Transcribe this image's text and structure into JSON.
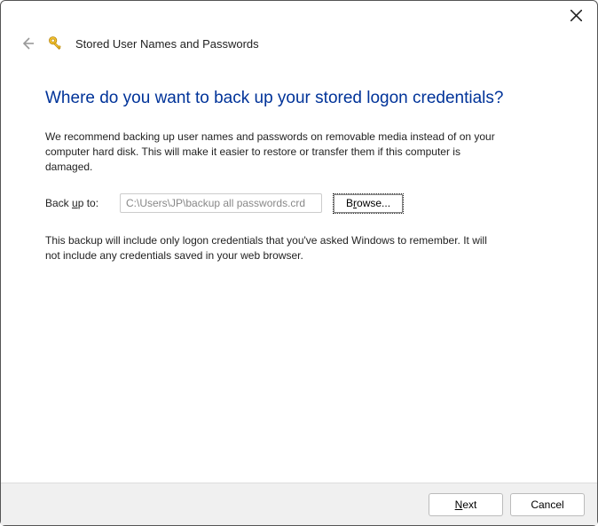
{
  "titlebar": {
    "close_tooltip": "Close"
  },
  "header": {
    "back_tooltip": "Back",
    "title": "Stored User Names and Passwords"
  },
  "main": {
    "heading": "Where do you want to back up your stored logon credentials?",
    "intro": "We recommend backing up user names and passwords on removable media instead of on your computer hard disk. This will make it easier to restore or transfer them if this computer is damaged.",
    "backup_label_pre": "Back ",
    "backup_label_accel": "u",
    "backup_label_post": "p to:",
    "path_value": "C:\\Users\\JP\\backup all passwords.crd",
    "browse_pre": "B",
    "browse_accel": "r",
    "browse_post": "owse...",
    "note": "This backup will include only logon credentials that you've asked Windows to remember. It will not include any credentials saved in your web browser."
  },
  "footer": {
    "next_accel": "N",
    "next_rest": "ext",
    "cancel": "Cancel"
  }
}
